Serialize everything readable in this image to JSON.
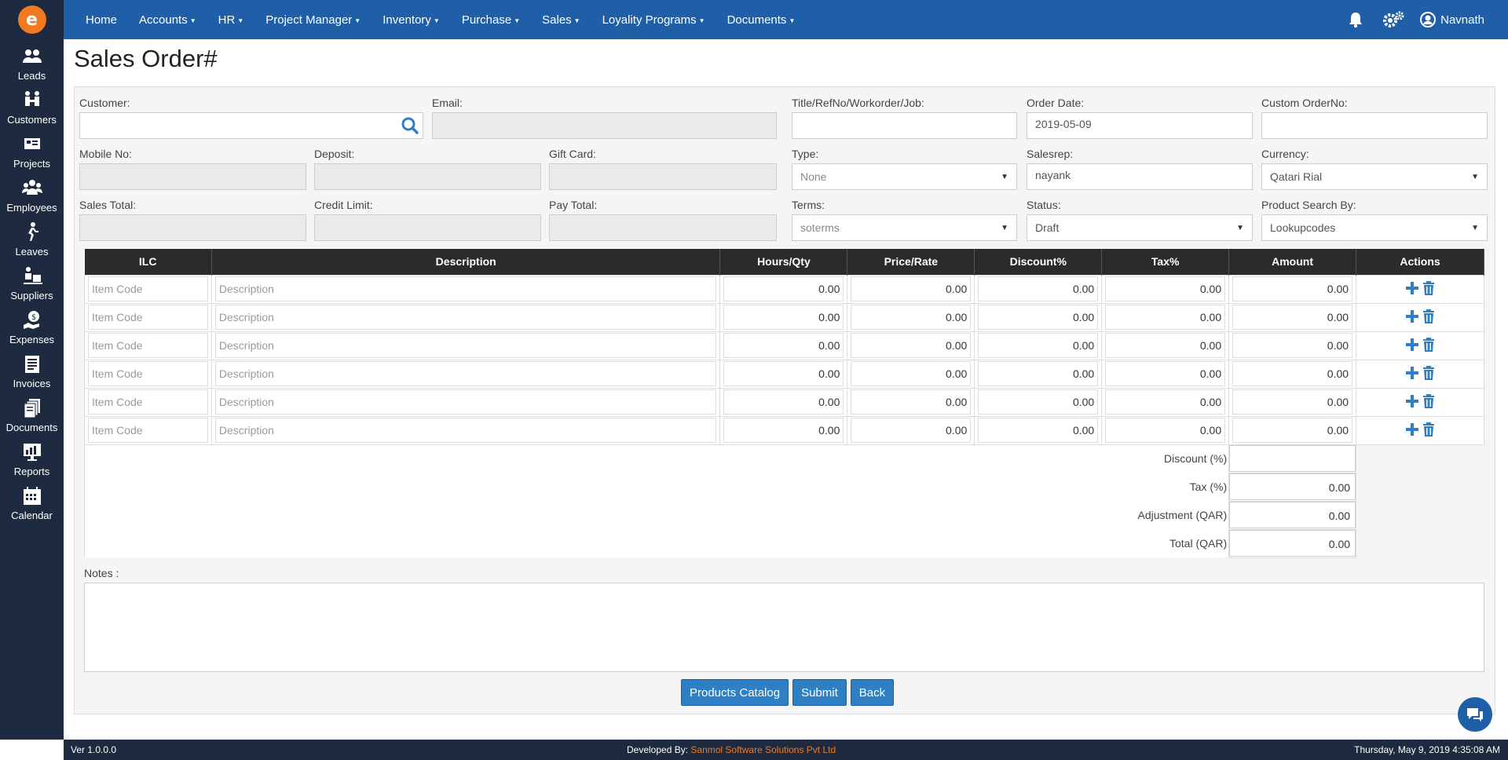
{
  "app": {
    "logo_letter": "e",
    "brand_color": "#f07a22",
    "nav_color": "#1f5fa7",
    "sidebar_color": "#1d2a3f"
  },
  "sidebar": {
    "items": [
      {
        "label": "Leads",
        "icon": "leads-icon"
      },
      {
        "label": "Customers",
        "icon": "customers-icon"
      },
      {
        "label": "Projects",
        "icon": "projects-icon"
      },
      {
        "label": "Employees",
        "icon": "employees-icon"
      },
      {
        "label": "Leaves",
        "icon": "leaves-icon"
      },
      {
        "label": "Suppliers",
        "icon": "suppliers-icon"
      },
      {
        "label": "Expenses",
        "icon": "expenses-icon"
      },
      {
        "label": "Invoices",
        "icon": "invoices-icon"
      },
      {
        "label": "Documents",
        "icon": "documents-icon"
      },
      {
        "label": "Reports",
        "icon": "reports-icon"
      },
      {
        "label": "Calendar",
        "icon": "calendar-icon"
      }
    ]
  },
  "topnav": {
    "items": [
      {
        "label": "Home",
        "dropdown": false
      },
      {
        "label": "Accounts",
        "dropdown": true
      },
      {
        "label": "HR",
        "dropdown": true
      },
      {
        "label": "Project Manager",
        "dropdown": true
      },
      {
        "label": "Inventory",
        "dropdown": true
      },
      {
        "label": "Purchase",
        "dropdown": true
      },
      {
        "label": "Sales",
        "dropdown": true
      },
      {
        "label": "Loyality Programs",
        "dropdown": true
      },
      {
        "label": "Documents",
        "dropdown": true
      }
    ],
    "user": "Navnath"
  },
  "page": {
    "title": "Sales Order#"
  },
  "form": {
    "customer": {
      "label": "Customer:",
      "value": ""
    },
    "email": {
      "label": "Email:",
      "value": ""
    },
    "title_ref": {
      "label": "Title/RefNo/Workorder/Job:",
      "value": ""
    },
    "order_date": {
      "label": "Order Date:",
      "value": "2019-05-09"
    },
    "custom_order_no": {
      "label": "Custom OrderNo:",
      "value": ""
    },
    "mobile": {
      "label": "Mobile No:",
      "value": ""
    },
    "deposit": {
      "label": "Deposit:",
      "value": ""
    },
    "gift_card": {
      "label": "Gift Card:",
      "value": ""
    },
    "type": {
      "label": "Type:",
      "value": "None"
    },
    "salesrep": {
      "label": "Salesrep:",
      "value": "nayank"
    },
    "currency": {
      "label": "Currency:",
      "value": "Qatari Rial"
    },
    "sales_total": {
      "label": "Sales Total:",
      "value": ""
    },
    "credit_limit": {
      "label": "Credit Limit:",
      "value": ""
    },
    "pay_total": {
      "label": "Pay Total:",
      "value": ""
    },
    "terms": {
      "label": "Terms:",
      "value": "soterms"
    },
    "status": {
      "label": "Status:",
      "value": "Draft"
    },
    "product_search": {
      "label": "Product Search By:",
      "value": "Lookupcodes"
    }
  },
  "table": {
    "headers": [
      "ILC",
      "Description",
      "Hours/Qty",
      "Price/Rate",
      "Discount%",
      "Tax%",
      "Amount",
      "Actions"
    ],
    "rows": [
      {
        "code": "Item Code",
        "desc": "Description",
        "qty": "0.00",
        "price": "0.00",
        "discount": "0.00",
        "tax": "0.00",
        "amount": "0.00"
      },
      {
        "code": "Item Code",
        "desc": "Description",
        "qty": "0.00",
        "price": "0.00",
        "discount": "0.00",
        "tax": "0.00",
        "amount": "0.00"
      },
      {
        "code": "Item Code",
        "desc": "Description",
        "qty": "0.00",
        "price": "0.00",
        "discount": "0.00",
        "tax": "0.00",
        "amount": "0.00"
      },
      {
        "code": "Item Code",
        "desc": "Description",
        "qty": "0.00",
        "price": "0.00",
        "discount": "0.00",
        "tax": "0.00",
        "amount": "0.00"
      },
      {
        "code": "Item Code",
        "desc": "Description",
        "qty": "0.00",
        "price": "0.00",
        "discount": "0.00",
        "tax": "0.00",
        "amount": "0.00"
      },
      {
        "code": "Item Code",
        "desc": "Description",
        "qty": "0.00",
        "price": "0.00",
        "discount": "0.00",
        "tax": "0.00",
        "amount": "0.00"
      }
    ],
    "summary": {
      "discount": {
        "label": "Discount (%)",
        "value": ""
      },
      "tax": {
        "label": "Tax (%)",
        "value": "0.00"
      },
      "adjustment": {
        "label": "Adjustment (QAR)",
        "value": "0.00"
      },
      "total": {
        "label": "Total (QAR)",
        "value": "0.00"
      }
    }
  },
  "notes": {
    "label": "Notes :",
    "value": ""
  },
  "buttons": {
    "catalog": "Products Catalog",
    "submit": "Submit",
    "back": "Back"
  },
  "footer": {
    "version": "Ver 1.0.0.0",
    "developed_by": "Developed By:",
    "company": "Sanmol Software Solutions Pvt Ltd",
    "datetime": "Thursday, May 9, 2019 4:35:08 AM"
  }
}
